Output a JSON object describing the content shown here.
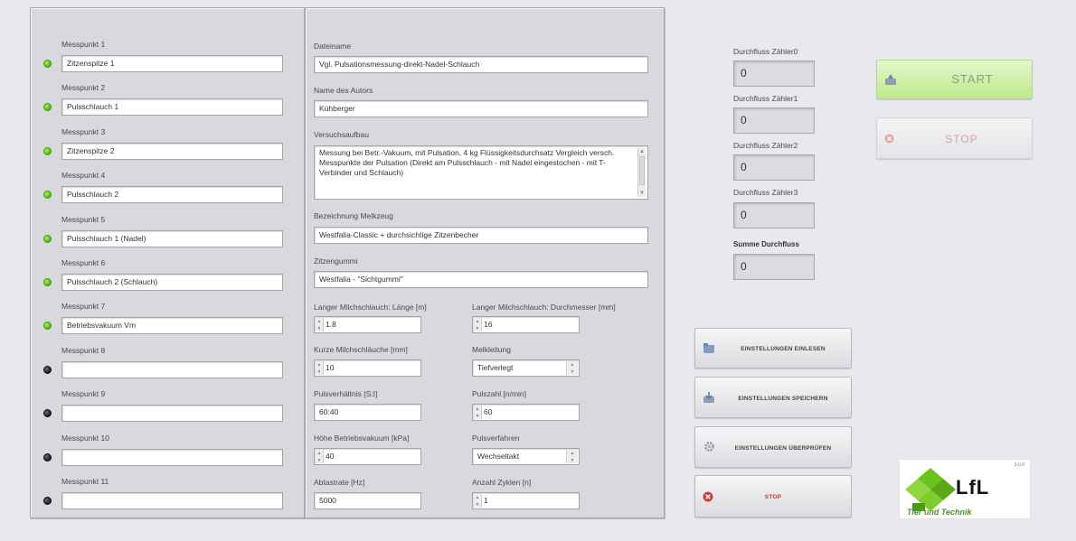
{
  "messpunkte": [
    {
      "label": "Messpunkt 1",
      "value": "Zitzenspitze 1",
      "active": true
    },
    {
      "label": "Messpunkt 2",
      "value": "Pulsschlauch 1",
      "active": true
    },
    {
      "label": "Messpunkt 3",
      "value": "Zitzenspitze 2",
      "active": true
    },
    {
      "label": "Messpunkt 4",
      "value": "Pulsschlauch 2",
      "active": true
    },
    {
      "label": "Messpunkt 5",
      "value": "Pulsschlauch 1 (Nadel)",
      "active": true
    },
    {
      "label": "Messpunkt 6",
      "value": "Pulsschlauch 2 (Schlauch)",
      "active": true
    },
    {
      "label": "Messpunkt 7",
      "value": "Betriebsvakuum Vm",
      "active": true
    },
    {
      "label": "Messpunkt 8",
      "value": "",
      "active": false
    },
    {
      "label": "Messpunkt 9",
      "value": "",
      "active": false
    },
    {
      "label": "Messpunkt 10",
      "value": "",
      "active": false
    },
    {
      "label": "Messpunkt 11",
      "value": "",
      "active": false
    }
  ],
  "mid": {
    "dateiname_label": "Dateiname",
    "dateiname": "Vgl. Pulsationsmessung-direkt-Nadel-Schlauch",
    "autor_label": "Name des Autors",
    "autor": "Kühberger",
    "aufbau_label": "Versuchsaufbau",
    "aufbau": "Messung bei Betr.-Vakuum, mit Pulsation, 4 kg Flüssigkeitsdurchsatz Vergleich versch. Messpunkte der Pulsation (Direkt am Pulsschlauch - mit Nadel eingestochen - mit T-Verbinder und Schlauch)",
    "melkzeug_label": "Bezeichnung Melkzeug",
    "melkzeug": "Westfalia-Classic + durchsichtige Zitzenbecher",
    "zitzengummi_label": "Zitzengummi",
    "zitzengummi": "Westfalia - \"Sichtgummi\"",
    "laenge_label": "Langer Milchschlauch: Länge [m]",
    "laenge": "1.8",
    "durchmesser_label": "Langer Milchschlauch: Durchmesser [mm]",
    "durchmesser": "16",
    "kurze_label": "Kurze Milchschläuche [mm]",
    "kurze": "10",
    "melkleitung_label": "Melkleitung",
    "melkleitung": "Tiefverlegt",
    "pulsverh_label": "Pulsverhältnis [S:I]",
    "pulsverh": "60:40",
    "pulszahl_label": "Pulszahl [n/min]",
    "pulszahl": "60",
    "vakuum_label": "Höhe Betriebsvakuum [kPa]",
    "vakuum": "40",
    "pulsverfahren_label": "Pulsverfahren",
    "pulsverfahren": "Wechseltakt",
    "abtastrate_label": "Abtastrate [Hz]",
    "abtastrate": "5000",
    "zyklen_label": "Anzahl Zyklen [n]",
    "zyklen": "1"
  },
  "counters": [
    {
      "label": "Durchfluss Zähler0",
      "value": "0"
    },
    {
      "label": "Durchfluss Zähler1",
      "value": "0"
    },
    {
      "label": "Durchfluss Zähler2",
      "value": "0"
    },
    {
      "label": "Durchfluss Zähler3",
      "value": "0"
    },
    {
      "label": "Summe Durchfluss",
      "value": "0"
    }
  ],
  "buttons": {
    "start": "START",
    "stop_big": "STOP",
    "einlesen": "EINSTELLUNGEN EINLESEN",
    "speichern": "EINSTELLUNGEN SPEICHERN",
    "ueberpruefen": "EINSTELLUNGEN ÜBERPRÜFEN",
    "stop_small": "STOP"
  },
  "logo": {
    "text": "LfL",
    "tagline": "Tier und Technik",
    "version": "3.0.0"
  },
  "colors": {
    "led_on": "#5dbb16",
    "led_off": "#222222",
    "start_bg": "#cdeea3",
    "logo_green": "#6cc21c",
    "logo_tagline": "#3f9a1a"
  }
}
